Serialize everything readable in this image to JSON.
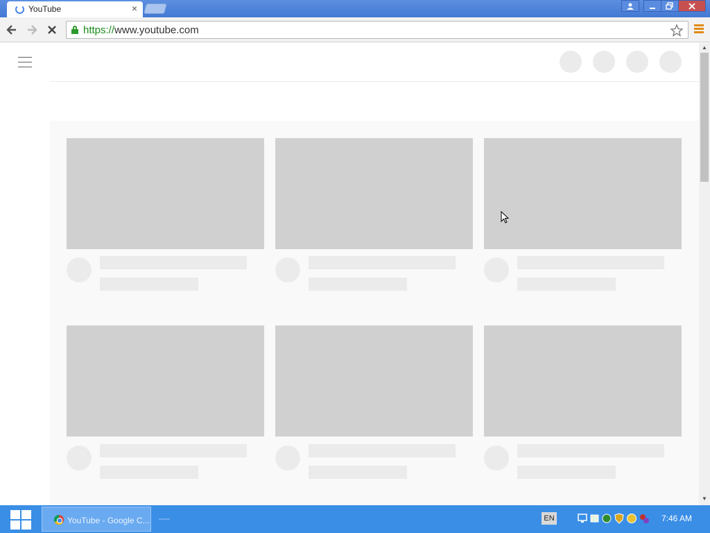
{
  "browser": {
    "tab_title": "YouTube",
    "tab_close": "×",
    "url_scheme": "https://",
    "url_rest": "www.youtube.com",
    "window_buttons": [
      "minimize",
      "restore",
      "close"
    ]
  },
  "taskbar": {
    "active_item": "YouTube - Google C...",
    "language": "EN",
    "time": "7:46 AM"
  },
  "colors": {
    "accent": "#3a8ee6",
    "placeholder_thumb": "#d0d0d0",
    "placeholder_text": "#ebebeb"
  }
}
